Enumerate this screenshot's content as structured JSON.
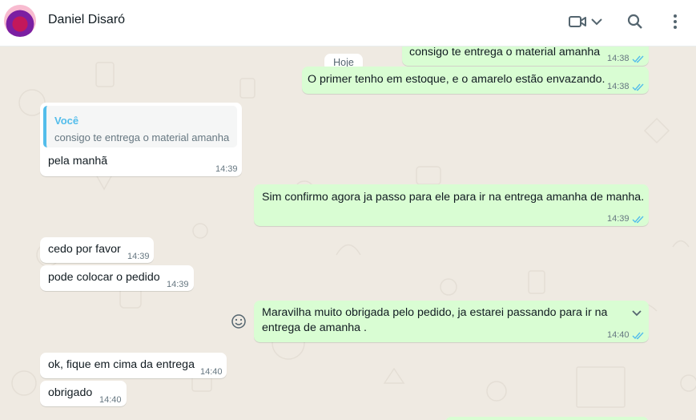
{
  "contact": {
    "name": "Daniel Disaró"
  },
  "header": {
    "icons": [
      "video-call-icon",
      "chevron-down-icon",
      "search-icon",
      "menu-icon"
    ]
  },
  "date_divider": "Hoje",
  "messages": [
    {
      "direction": "out",
      "text": "consigo te entrega o material amanha",
      "time": "14:38",
      "status": "read"
    },
    {
      "direction": "out",
      "text": "O primer tenho em estoque, e o amarelo estão envazando.",
      "time": "14:38",
      "status": "read"
    },
    {
      "direction": "in",
      "reply_to": {
        "author": "Você",
        "text": "consigo te entrega o material amanha"
      },
      "text": "pela manhã",
      "time": "14:39"
    },
    {
      "direction": "out",
      "text": "Sim confirmo agora ja passo para ele para ir na entrega amanha de manha.",
      "time": "14:39",
      "status": "read"
    },
    {
      "direction": "in",
      "text": "cedo por favor",
      "time": "14:39"
    },
    {
      "direction": "in",
      "text": "pode colocar o pedido",
      "time": "14:39"
    },
    {
      "direction": "out",
      "text_line1": "Maravilha muito obrigada pelo pedido, ja estarei passando para ir  na",
      "text_line2": "entrega de amanha .",
      "time": "14:40",
      "status": "read"
    },
    {
      "direction": "in",
      "text": "ok, fique em cima da entrega",
      "time": "14:40"
    },
    {
      "direction": "in",
      "text": "obrigado",
      "time": "14:40"
    }
  ],
  "colors": {
    "outgoing_bubble": "#d9fdd3",
    "incoming_bubble": "#ffffff",
    "chat_background": "#efeae2",
    "read_ticks": "#53bdeb",
    "quote_accent": "#53bdeb"
  }
}
